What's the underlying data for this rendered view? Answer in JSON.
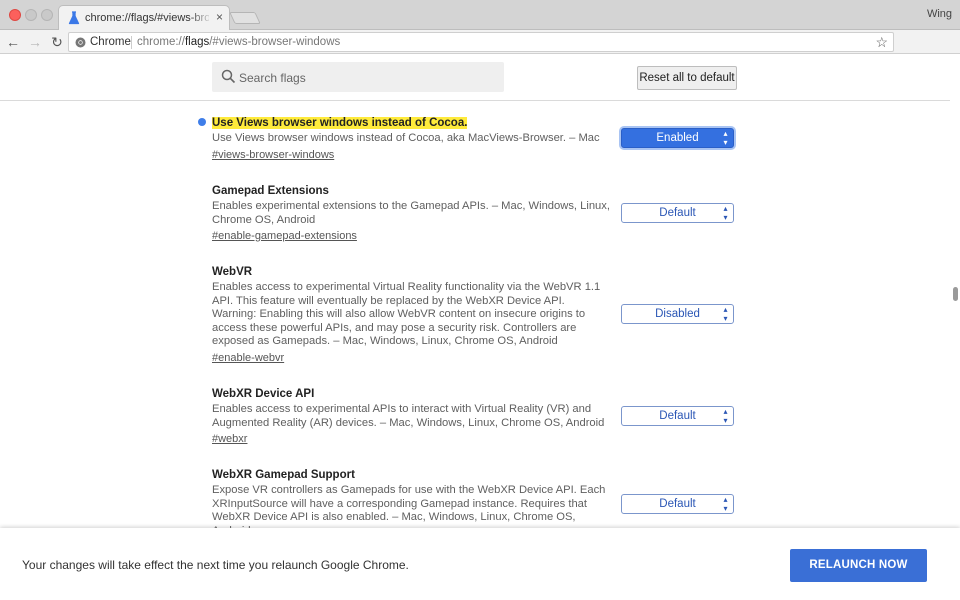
{
  "browser": {
    "tab_title": "chrome://flags/#views-browser-windows",
    "tab_close": "×",
    "profile_name": "Wing",
    "omnibox_label": "Chrome",
    "url_prefix": "chrome://",
    "url_host": "flags",
    "url_rest": "/#views-browser-windows",
    "nav": {
      "back": "←",
      "forward": "→",
      "reload": "↻"
    },
    "star": "☆",
    "menu": "⋮"
  },
  "header": {
    "search_placeholder": "Search flags",
    "reset_label": "Reset all to default"
  },
  "flags": [
    {
      "title": "Use Views browser windows instead of Cocoa.",
      "description": "Use Views browser windows instead of Cocoa, aka MacViews-Browser. – Mac",
      "link": "#views-browser-windows",
      "value": "Enabled",
      "highlighted": true,
      "active": true
    },
    {
      "title": "Gamepad Extensions",
      "description": "Enables experimental extensions to the Gamepad APIs. – Mac, Windows, Linux, Chrome OS, Android",
      "link": "#enable-gamepad-extensions",
      "value": "Default"
    },
    {
      "title": "WebVR",
      "description": "Enables access to experimental Virtual Reality functionality via the WebVR 1.1 API. This feature will eventually be replaced by the WebXR Device API. Warning: Enabling this will also allow WebVR content on insecure origins to access these powerful APIs, and may pose a security risk. Controllers are exposed as Gamepads. – Mac, Windows, Linux, Chrome OS, Android",
      "link": "#enable-webvr",
      "value": "Disabled"
    },
    {
      "title": "WebXR Device API",
      "description": "Enables access to experimental APIs to interact with Virtual Reality (VR) and Augmented Reality (AR) devices. – Mac, Windows, Linux, Chrome OS, Android",
      "link": "#webxr",
      "value": "Default"
    },
    {
      "title": "WebXR Gamepad Support",
      "description": "Expose VR controllers as Gamepads for use with the WebXR Device API. Each XRInputSource will have a corresponding Gamepad instance. Requires that WebXR Device API is also enabled. – Mac, Windows, Linux, Chrome OS, Android",
      "link": "",
      "value": "Default"
    }
  ],
  "relaunch": {
    "message": "Your changes will take effect the next time you relaunch Google Chrome.",
    "button": "RELAUNCH NOW"
  },
  "colors": {
    "accent": "#3a6fd6",
    "highlight": "#ffeb3b",
    "close_button": "#fc605c",
    "opera": "#e0232c"
  },
  "icons": [
    "flask-icon",
    "chrome-icon",
    "search-icon",
    "star-icon",
    "opera-icon",
    "extension-badge-icon",
    "menu-icon"
  ]
}
